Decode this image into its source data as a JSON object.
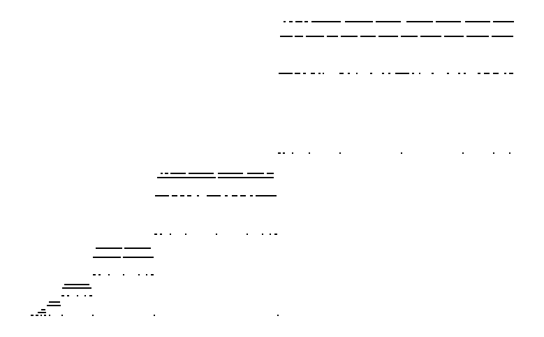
{
  "canvas": {
    "background": "#ffffff",
    "ink": "#000000"
  }
}
